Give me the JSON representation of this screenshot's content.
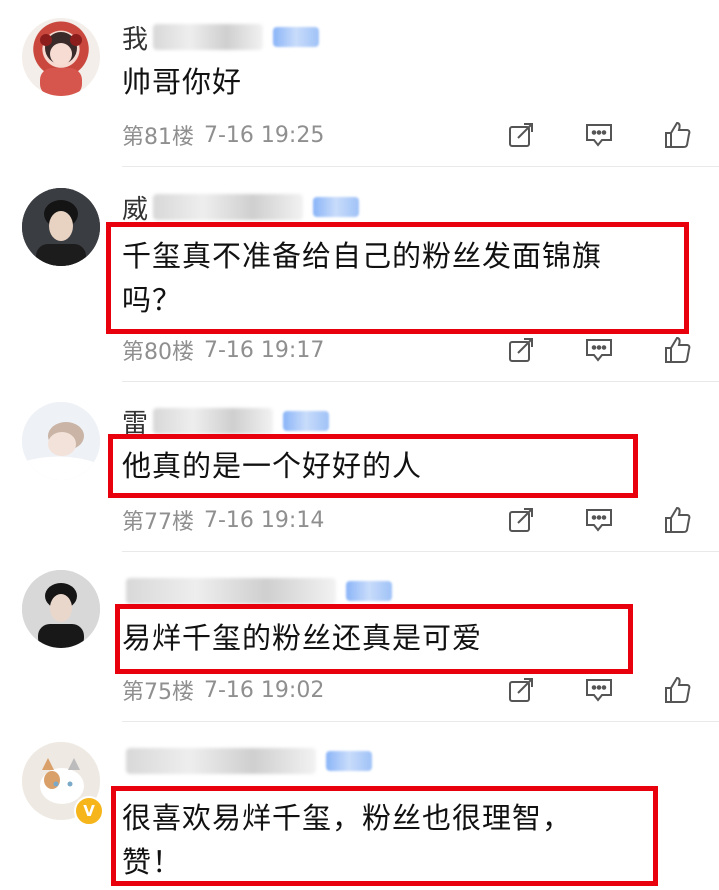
{
  "comments": [
    {
      "name": "我",
      "text": "帅哥你好",
      "floor": "第81楼",
      "time": "7-16 19:25"
    },
    {
      "name": "威",
      "text_line1": "千玺真不准备给自己的粉丝发面锦旗",
      "text_line2": "吗？",
      "floor": "第80楼",
      "time": "7-16 19:17"
    },
    {
      "name": "雷",
      "text": "他真的是一个好好的人",
      "floor": "第77楼",
      "time": "7-16 19:14"
    },
    {
      "name": "",
      "text": "易烊千玺的粉丝还真是可爱",
      "floor": "第75楼",
      "time": "7-16 19:02"
    },
    {
      "name": "",
      "text_line1": "很喜欢易烊千玺，粉丝也很理智，",
      "text_line2": "赞！",
      "verified_mark": "V"
    }
  ],
  "colors": {
    "highlight": "#e8000d",
    "meta": "#8f8f8f",
    "icon": "#555555"
  },
  "icons": [
    "forward-icon",
    "comment-icon",
    "like-icon"
  ]
}
